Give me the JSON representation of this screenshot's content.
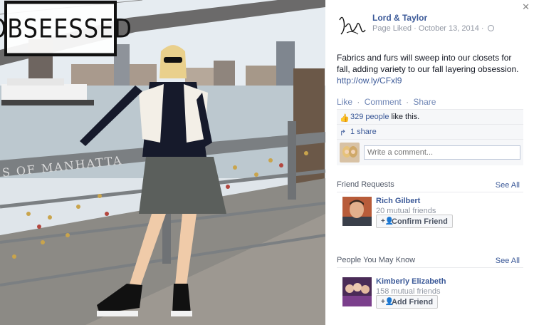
{
  "photo": {
    "stamp_text": "OBSEESSED",
    "railing_text": "S OF MANHATTA"
  },
  "post": {
    "page_name": "Lord & Taylor",
    "meta_status": "Page Liked",
    "date": "October 13, 2014",
    "separator": "·",
    "text": "Fabrics and furs will sweep into our closets for fall, adding variety to our fall layering obsession.",
    "link": "http://ow.ly/CFxl9",
    "logo_text": "Lord & Taylor"
  },
  "actions": {
    "like": "Like",
    "comment": "Comment",
    "share": "Share",
    "dot": "·"
  },
  "likes": {
    "count_text": "329 people",
    "suffix": "like this."
  },
  "shares": {
    "text": "1 share"
  },
  "comment": {
    "placeholder": "Write a comment..."
  },
  "friend_requests": {
    "title": "Friend Requests",
    "see_all": "See All",
    "items": [
      {
        "name": "Rich Gilbert",
        "mutual": "20 mutual friends",
        "button": "Confirm Friend"
      }
    ]
  },
  "people_you_may_know": {
    "title": "People You May Know",
    "see_all": "See All",
    "items": [
      {
        "name": "Kimberly Elizabeth",
        "mutual": "158 mutual friends",
        "button": "Add Friend"
      }
    ]
  },
  "icons": {
    "close": "close-icon",
    "globe": "globe-icon",
    "like": "thumbs-up-icon",
    "share": "share-arrow-icon",
    "add_friend": "add-friend-icon"
  },
  "colors": {
    "link_blue": "#3b5998",
    "muted": "#9197a3",
    "panel_gray": "#f6f7f9"
  }
}
